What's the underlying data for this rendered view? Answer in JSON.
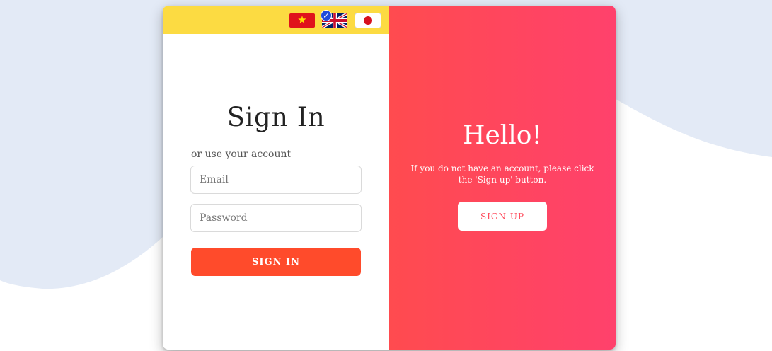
{
  "languages": [
    {
      "name": "vietnamese-flag",
      "selected": false
    },
    {
      "name": "english-flag",
      "selected": true
    },
    {
      "name": "japanese-flag",
      "selected": false
    }
  ],
  "colors": {
    "language_bar": "#fcdb42",
    "primary_button": "#ff4b2b",
    "panel_gradient_start": "#ff4b4f",
    "panel_gradient_end": "#ff416c",
    "background_wave": "#e3eaf6"
  },
  "signin": {
    "title": "Sign In",
    "subtitle": "or use your account",
    "email_placeholder": "Email",
    "password_placeholder": "Password",
    "button_label": "SIGN IN"
  },
  "overlay": {
    "title": "Hello!",
    "message": "If you do not have an account, please click the 'Sign up' button.",
    "button_label": "SIGN UP"
  }
}
